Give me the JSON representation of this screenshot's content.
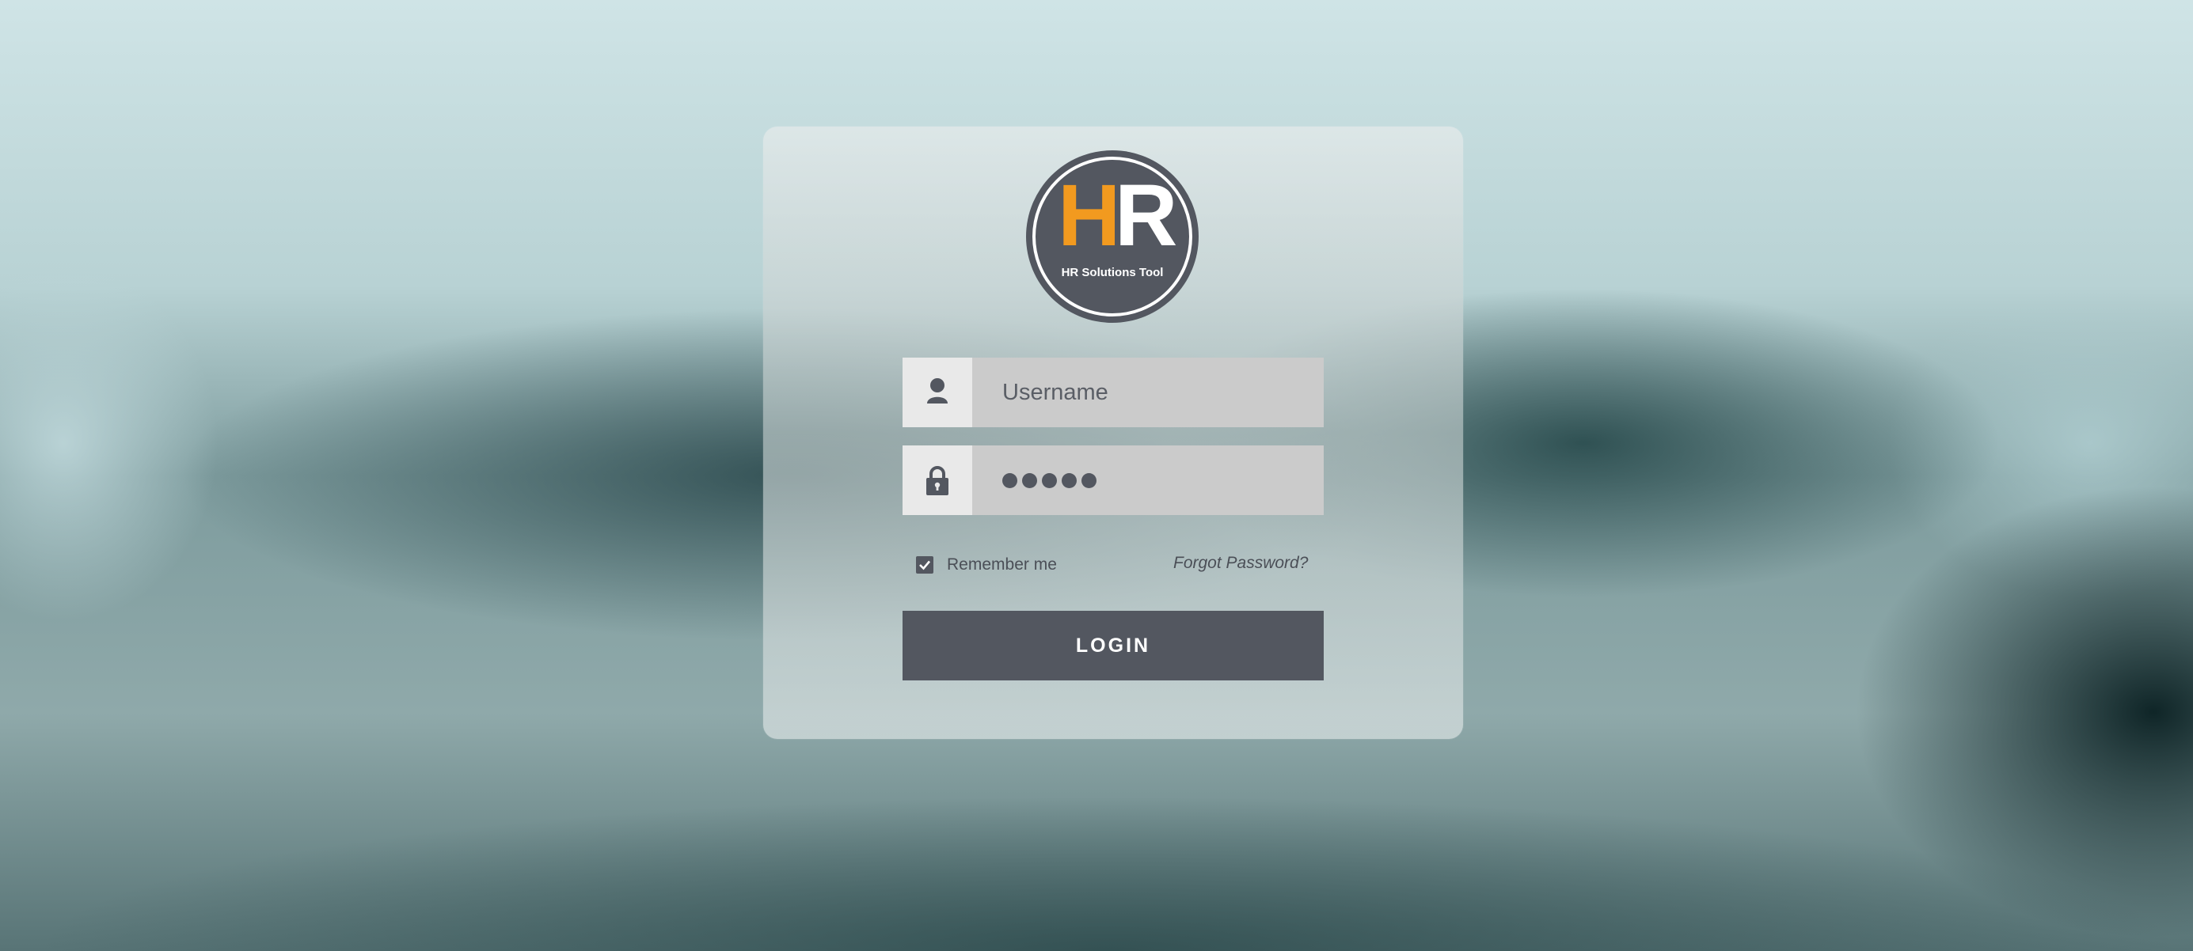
{
  "logo": {
    "letter_h": "H",
    "letter_r": "R",
    "subtitle": "HR Solutions Tool",
    "color_h": "#f29a1f",
    "color_badge": "#535760"
  },
  "form": {
    "username": {
      "placeholder": "Username",
      "value": "",
      "icon": "user-icon"
    },
    "password": {
      "masked_length": 5,
      "icon": "lock-icon"
    },
    "remember_me": {
      "label": "Remember me",
      "checked": true
    },
    "forgot_password": "Forgot Password?",
    "login_button": "LOGIN"
  },
  "colors": {
    "accent": "#f29a1f",
    "primary": "#535760",
    "field_bg": "#cbcbcb",
    "icon_box_bg": "#e9e9e9"
  }
}
